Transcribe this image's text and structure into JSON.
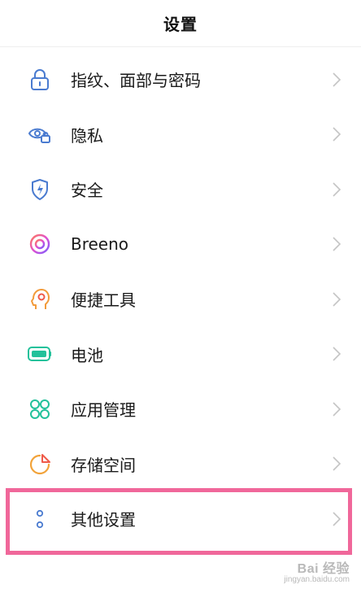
{
  "header": {
    "title": "设置"
  },
  "items": [
    {
      "label": "指纹、面部与密码",
      "icon": "lock-icon",
      "color": "#4a7bd0"
    },
    {
      "label": "隐私",
      "icon": "eye-lock-icon",
      "color": "#4a7bd0"
    },
    {
      "label": "安全",
      "icon": "shield-icon",
      "color": "#4a7bd0"
    },
    {
      "label": "Breeno",
      "icon": "breeno-icon",
      "color": "#c35cf0"
    },
    {
      "label": "便捷工具",
      "icon": "assistant-head-icon",
      "color": "#f29b3b"
    },
    {
      "label": "电池",
      "icon": "battery-icon",
      "color": "#22c19a"
    },
    {
      "label": "应用管理",
      "icon": "app-grid-icon",
      "color": "#22c19a"
    },
    {
      "label": "存储空间",
      "icon": "pie-chart-icon",
      "color": "#f2a33a"
    },
    {
      "label": "其他设置",
      "icon": "more-dots-icon",
      "color": "#4a7bd0"
    }
  ],
  "highlight_color": "#f0679a",
  "watermark": {
    "main": "Bai 经验",
    "sub": "jingyan.baidu.com"
  }
}
